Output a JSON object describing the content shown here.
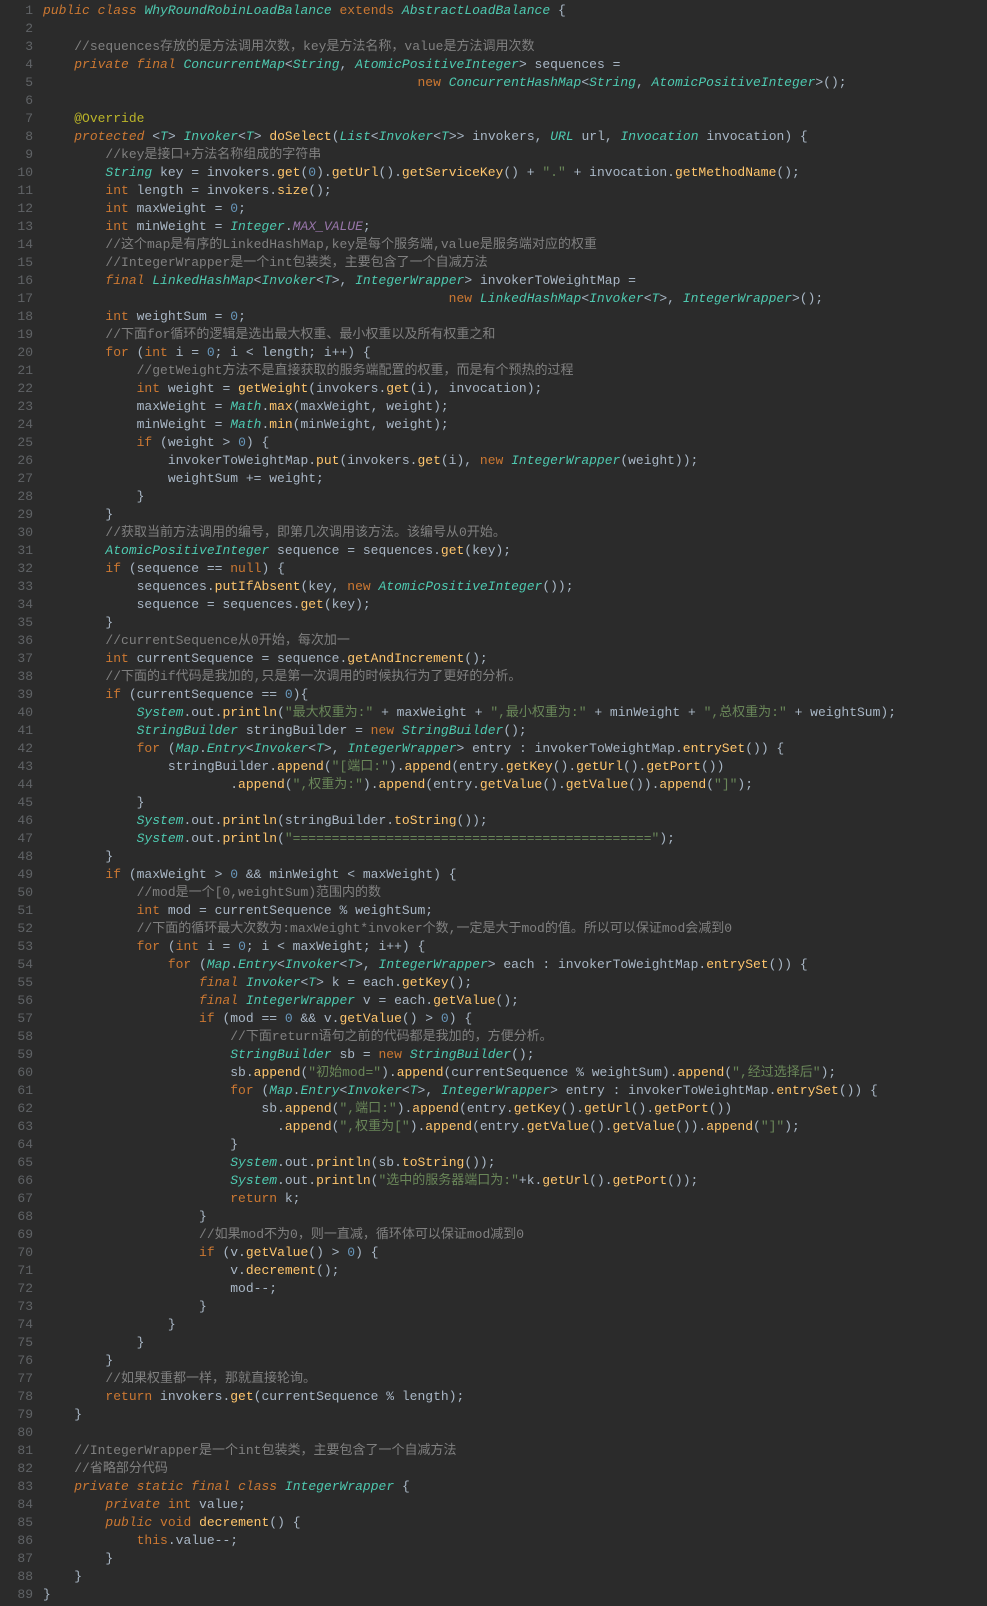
{
  "lines": [
    {
      "n": 1,
      "html": "<span class='kw'>public</span> <span class='kw'>class</span> <span class='cls'>WhyRoundRobinLoadBalance</span> <span class='kw2'>extends</span> <span class='cls'>AbstractLoadBalance</span> {"
    },
    {
      "n": 2,
      "html": ""
    },
    {
      "n": 3,
      "html": "    <span class='cmt'>//sequences存放的是方法调用次数，key是方法名称，value是方法调用次数</span>"
    },
    {
      "n": 4,
      "html": "    <span class='kw'>private</span> <span class='kw'>final</span> <span class='type'>ConcurrentMap</span>&lt;<span class='type'>String</span>, <span class='type'>AtomicPositiveInteger</span>&gt; sequences ="
    },
    {
      "n": 5,
      "html": "                                                <span class='kw2'>new</span> <span class='type'>ConcurrentHashMap</span>&lt;<span class='type'>String</span>, <span class='type'>AtomicPositiveInteger</span>&gt;();"
    },
    {
      "n": 6,
      "html": ""
    },
    {
      "n": 7,
      "html": "    <span class='ann'>@Override</span>"
    },
    {
      "n": 8,
      "html": "    <span class='kw'>protected</span> &lt;<span class='type'>T</span>&gt; <span class='type'>Invoker</span>&lt;<span class='type'>T</span>&gt; <span class='fn'>doSelect</span>(<span class='type'>List</span>&lt;<span class='type'>Invoker</span>&lt;<span class='type'>T</span>&gt;&gt; <span class='param'>invokers</span>, <span class='type'>URL</span> <span class='param'>url</span>, <span class='type'>Invocation</span> <span class='param'>invocation</span>) {"
    },
    {
      "n": 9,
      "html": "        <span class='cmt'>//key是接口+方法名称组成的字符串</span>"
    },
    {
      "n": 10,
      "html": "        <span class='type'>String</span> key = invokers.<span class='fn'>get</span>(<span class='num'>0</span>).<span class='fn'>getUrl</span>().<span class='fn'>getServiceKey</span>() + <span class='str'>\".\"</span> + invocation.<span class='fn'>getMethodName</span>();"
    },
    {
      "n": 11,
      "html": "        <span class='kw2'>int</span> length = invokers.<span class='fn'>size</span>();"
    },
    {
      "n": 12,
      "html": "        <span class='kw2'>int</span> maxWeight = <span class='num'>0</span>;"
    },
    {
      "n": 13,
      "html": "        <span class='kw2'>int</span> minWeight = <span class='type'>Integer</span>.<span class='const'>MAX_VALUE</span>;"
    },
    {
      "n": 14,
      "html": "        <span class='cmt'>//这个map是有序的LinkedHashMap,key是每个服务端,value是服务端对应的权重</span>"
    },
    {
      "n": 15,
      "html": "        <span class='cmt'>//IntegerWrapper是一个int包装类，主要包含了一个自减方法</span>"
    },
    {
      "n": 16,
      "html": "        <span class='kw'>final</span> <span class='type'>LinkedHashMap</span>&lt;<span class='type'>Invoker</span>&lt;<span class='type'>T</span>&gt;, <span class='type'>IntegerWrapper</span>&gt; invokerToWeightMap ="
    },
    {
      "n": 17,
      "html": "                                                    <span class='kw2'>new</span> <span class='type'>LinkedHashMap</span>&lt;<span class='type'>Invoker</span>&lt;<span class='type'>T</span>&gt;, <span class='type'>IntegerWrapper</span>&gt;();"
    },
    {
      "n": 18,
      "html": "        <span class='kw2'>int</span> weightSum = <span class='num'>0</span>;"
    },
    {
      "n": 19,
      "html": "        <span class='cmt'>//下面for循环的逻辑是选出最大权重、最小权重以及所有权重之和</span>"
    },
    {
      "n": 20,
      "html": "        <span class='kw2'>for</span> (<span class='kw2'>int</span> i = <span class='num'>0</span>; i &lt; length; i++) {"
    },
    {
      "n": 21,
      "html": "            <span class='cmt'>//getWeight方法不是直接获取的服务端配置的权重，而是有个预热的过程</span>"
    },
    {
      "n": 22,
      "html": "            <span class='kw2'>int</span> weight = <span class='fn'>getWeight</span>(invokers.<span class='fn'>get</span>(i), invocation);"
    },
    {
      "n": 23,
      "html": "            maxWeight = <span class='type'>Math</span>.<span class='fn'>max</span>(maxWeight, weight);"
    },
    {
      "n": 24,
      "html": "            minWeight = <span class='type'>Math</span>.<span class='fn'>min</span>(minWeight, weight);"
    },
    {
      "n": 25,
      "html": "            <span class='kw2'>if</span> (weight &gt; <span class='num'>0</span>) {"
    },
    {
      "n": 26,
      "html": "                invokerToWeightMap.<span class='fn'>put</span>(invokers.<span class='fn'>get</span>(i), <span class='kw2'>new</span> <span class='type'>IntegerWrapper</span>(weight));"
    },
    {
      "n": 27,
      "html": "                weightSum += weight;"
    },
    {
      "n": 28,
      "html": "            }"
    },
    {
      "n": 29,
      "html": "        }"
    },
    {
      "n": 30,
      "html": "        <span class='cmt'>//获取当前方法调用的编号，即第几次调用该方法。该编号从0开始。</span>"
    },
    {
      "n": 31,
      "html": "        <span class='type'>AtomicPositiveInteger</span> sequence = sequences.<span class='fn'>get</span>(key);"
    },
    {
      "n": 32,
      "html": "        <span class='kw2'>if</span> (sequence == <span class='kw2'>null</span>) {"
    },
    {
      "n": 33,
      "html": "            sequences.<span class='fn'>putIfAbsent</span>(key, <span class='kw2'>new</span> <span class='type'>AtomicPositiveInteger</span>());"
    },
    {
      "n": 34,
      "html": "            sequence = sequences.<span class='fn'>get</span>(key);"
    },
    {
      "n": 35,
      "html": "        }"
    },
    {
      "n": 36,
      "html": "        <span class='cmt'>//currentSequence从0开始，每次加一</span>"
    },
    {
      "n": 37,
      "html": "        <span class='kw2'>int</span> currentSequence = sequence.<span class='fn'>getAndIncrement</span>();"
    },
    {
      "n": 38,
      "html": "        <span class='cmt'>//下面的if代码是我加的,只是第一次调用的时候执行为了更好的分析。</span>"
    },
    {
      "n": 39,
      "html": "        <span class='kw2'>if</span> (currentSequence == <span class='num'>0</span>){"
    },
    {
      "n": 40,
      "html": "            <span class='type'>System</span>.out.<span class='fn'>println</span>(<span class='str'>\"最大权重为:\"</span> + maxWeight + <span class='str'>\",最小权重为:\"</span> + minWeight + <span class='str'>\",总权重为:\"</span> + weightSum);"
    },
    {
      "n": 41,
      "html": "            <span class='type'>StringBuilder</span> stringBuilder = <span class='kw2'>new</span> <span class='type'>StringBuilder</span>();"
    },
    {
      "n": 42,
      "html": "            <span class='kw2'>for</span> (<span class='type'>Map</span>.<span class='type'>Entry</span>&lt;<span class='type'>Invoker</span>&lt;<span class='type'>T</span>&gt;, <span class='type'>IntegerWrapper</span>&gt; entry : invokerToWeightMap.<span class='fn'>entrySet</span>()) {"
    },
    {
      "n": 43,
      "html": "                stringBuilder.<span class='fn'>append</span>(<span class='str'>\"[端口:\"</span>).<span class='fn'>append</span>(entry.<span class='fn'>getKey</span>().<span class='fn'>getUrl</span>().<span class='fn'>getPort</span>())"
    },
    {
      "n": 44,
      "html": "                        .<span class='fn'>append</span>(<span class='str'>\",权重为:\"</span>).<span class='fn'>append</span>(entry.<span class='fn'>getValue</span>().<span class='fn'>getValue</span>()).<span class='fn'>append</span>(<span class='str'>\"]\"</span>);"
    },
    {
      "n": 45,
      "html": "            }"
    },
    {
      "n": 46,
      "html": "            <span class='type'>System</span>.out.<span class='fn'>println</span>(stringBuilder.<span class='fn'>toString</span>());"
    },
    {
      "n": 47,
      "html": "            <span class='type'>System</span>.out.<span class='fn'>println</span>(<span class='str'>\"==============================================\"</span>);"
    },
    {
      "n": 48,
      "html": "        }"
    },
    {
      "n": 49,
      "html": "        <span class='kw2'>if</span> (maxWeight &gt; <span class='num'>0</span> &amp;&amp; minWeight &lt; maxWeight) {"
    },
    {
      "n": 50,
      "html": "            <span class='cmt'>//mod是一个[0,weightSum)范围内的数</span>"
    },
    {
      "n": 51,
      "html": "            <span class='kw2'>int</span> mod = currentSequence % weightSum;"
    },
    {
      "n": 52,
      "html": "            <span class='cmt'>//下面的循环最大次数为:maxWeight*invoker个数,一定是大于mod的值。所以可以保证mod会减到0</span>"
    },
    {
      "n": 53,
      "html": "            <span class='kw2'>for</span> (<span class='kw2'>int</span> i = <span class='num'>0</span>; i &lt; maxWeight; i++) {"
    },
    {
      "n": 54,
      "html": "                <span class='kw2'>for</span> (<span class='type'>Map</span>.<span class='type'>Entry</span>&lt;<span class='type'>Invoker</span>&lt;<span class='type'>T</span>&gt;, <span class='type'>IntegerWrapper</span>&gt; each : invokerToWeightMap.<span class='fn'>entrySet</span>()) {"
    },
    {
      "n": 55,
      "html": "                    <span class='kw'>final</span> <span class='type'>Invoker</span>&lt;<span class='type'>T</span>&gt; k = each.<span class='fn'>getKey</span>();"
    },
    {
      "n": 56,
      "html": "                    <span class='kw'>final</span> <span class='type'>IntegerWrapper</span> v = each.<span class='fn'>getValue</span>();"
    },
    {
      "n": 57,
      "html": "                    <span class='kw2'>if</span> (mod == <span class='num'>0</span> &amp;&amp; v.<span class='fn'>getValue</span>() &gt; <span class='num'>0</span>) {"
    },
    {
      "n": 58,
      "html": "                        <span class='cmt'>//下面return语句之前的代码都是我加的，方便分析。</span>"
    },
    {
      "n": 59,
      "html": "                        <span class='type'>StringBuilder</span> sb = <span class='kw2'>new</span> <span class='type'>StringBuilder</span>();"
    },
    {
      "n": 60,
      "html": "                        sb.<span class='fn'>append</span>(<span class='str'>\"初始mod=\"</span>).<span class='fn'>append</span>(currentSequence % weightSum).<span class='fn'>append</span>(<span class='str'>\",经过选择后\"</span>);"
    },
    {
      "n": 61,
      "html": "                        <span class='kw2'>for</span> (<span class='type'>Map</span>.<span class='type'>Entry</span>&lt;<span class='type'>Invoker</span>&lt;<span class='type'>T</span>&gt;, <span class='type'>IntegerWrapper</span>&gt; entry : invokerToWeightMap.<span class='fn'>entrySet</span>()) {"
    },
    {
      "n": 62,
      "html": "                            sb.<span class='fn'>append</span>(<span class='str'>\",端口:\"</span>).<span class='fn'>append</span>(entry.<span class='fn'>getKey</span>().<span class='fn'>getUrl</span>().<span class='fn'>getPort</span>())"
    },
    {
      "n": 63,
      "html": "                              .<span class='fn'>append</span>(<span class='str'>\",权重为[\"</span>).<span class='fn'>append</span>(entry.<span class='fn'>getValue</span>().<span class='fn'>getValue</span>()).<span class='fn'>append</span>(<span class='str'>\"]\"</span>);"
    },
    {
      "n": 64,
      "html": "                        }"
    },
    {
      "n": 65,
      "html": "                        <span class='type'>System</span>.out.<span class='fn'>println</span>(sb.<span class='fn'>toString</span>());"
    },
    {
      "n": 66,
      "html": "                        <span class='type'>System</span>.out.<span class='fn'>println</span>(<span class='str'>\"选中的服务器端口为:\"</span>+k.<span class='fn'>getUrl</span>().<span class='fn'>getPort</span>());"
    },
    {
      "n": 67,
      "html": "                        <span class='kw2'>return</span> k;"
    },
    {
      "n": 68,
      "html": "                    }"
    },
    {
      "n": 69,
      "html": "                    <span class='cmt'>//如果mod不为0，则一直减，循环体可以保证mod减到0</span>"
    },
    {
      "n": 70,
      "html": "                    <span class='kw2'>if</span> (v.<span class='fn'>getValue</span>() &gt; <span class='num'>0</span>) {"
    },
    {
      "n": 71,
      "html": "                        v.<span class='fn'>decrement</span>();"
    },
    {
      "n": 72,
      "html": "                        mod--;"
    },
    {
      "n": 73,
      "html": "                    }"
    },
    {
      "n": 74,
      "html": "                }"
    },
    {
      "n": 75,
      "html": "            }"
    },
    {
      "n": 76,
      "html": "        }"
    },
    {
      "n": 77,
      "html": "        <span class='cmt'>//如果权重都一样，那就直接轮询。</span>"
    },
    {
      "n": 78,
      "html": "        <span class='kw2'>return</span> invokers.<span class='fn'>get</span>(currentSequence % length);"
    },
    {
      "n": 79,
      "html": "    }"
    },
    {
      "n": 80,
      "html": ""
    },
    {
      "n": 81,
      "html": "    <span class='cmt'>//IntegerWrapper是一个int包装类，主要包含了一个自减方法</span>"
    },
    {
      "n": 82,
      "html": "    <span class='cmt'>//省略部分代码</span>"
    },
    {
      "n": 83,
      "html": "    <span class='kw'>private</span> <span class='kw'>static</span> <span class='kw'>final</span> <span class='kw'>class</span> <span class='cls'>IntegerWrapper</span> {"
    },
    {
      "n": 84,
      "html": "        <span class='kw'>private</span> <span class='kw2'>int</span> value;"
    },
    {
      "n": 85,
      "html": "        <span class='kw'>public</span> <span class='kw2'>void</span> <span class='fn'>decrement</span>() {"
    },
    {
      "n": 86,
      "html": "            <span class='kw2'>this</span>.value--;"
    },
    {
      "n": 87,
      "html": "        }"
    },
    {
      "n": 88,
      "html": "    }"
    },
    {
      "n": 89,
      "html": "}"
    }
  ]
}
